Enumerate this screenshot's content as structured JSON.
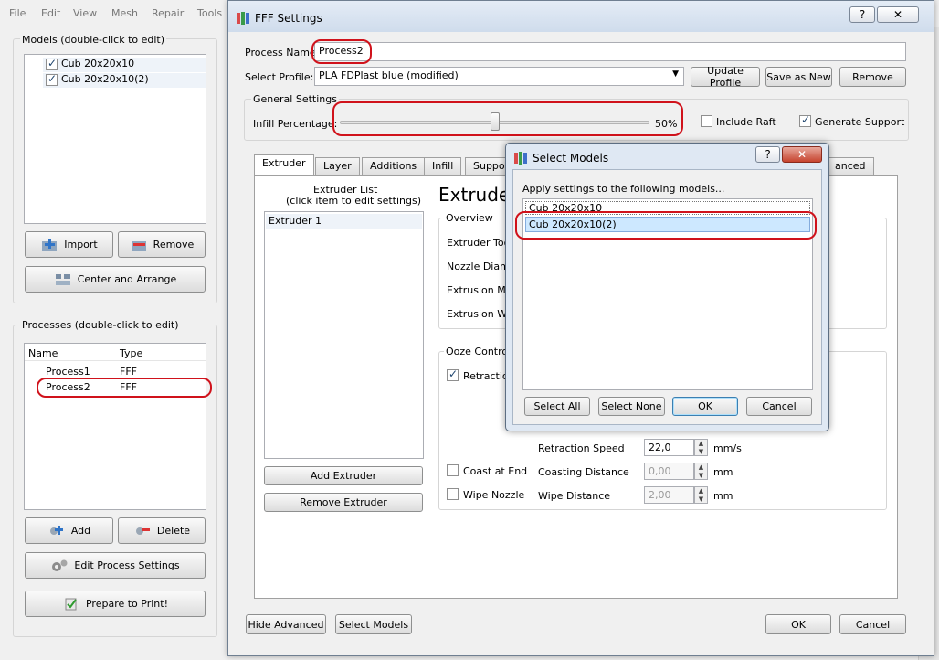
{
  "menu": {
    "items": [
      "File",
      "Edit",
      "View",
      "Mesh",
      "Repair",
      "Tools"
    ]
  },
  "models_panel": {
    "title": "Models (double-click to edit)",
    "items": [
      {
        "label": "Cub 20x20x10",
        "checked": true
      },
      {
        "label": "Cub 20x20x10(2)",
        "checked": true
      }
    ],
    "import_label": "Import",
    "remove_label": "Remove",
    "center_label": "Center and Arrange"
  },
  "processes_panel": {
    "title": "Processes (double-click to edit)",
    "col_name": "Name",
    "col_type": "Type",
    "rows": [
      {
        "name": "Process1",
        "type": "FFF"
      },
      {
        "name": "Process2",
        "type": "FFF"
      }
    ],
    "add_label": "Add",
    "delete_label": "Delete",
    "edit_label": "Edit Process Settings",
    "prepare_label": "Prepare to Print!"
  },
  "fff": {
    "title": "FFF Settings",
    "help": "?",
    "close": "✕",
    "process_name_label": "Process Name:",
    "process_name_value": "Process2",
    "profile_label": "Select Profile:",
    "profile_value": "PLA FDPlast blue (modified)",
    "update_profile": "Update Profile",
    "save_as_new": "Save as New",
    "remove": "Remove",
    "general_settings": "General Settings",
    "infill_label": "Infill Percentage:",
    "infill_value": "50%",
    "infill_fraction": 0.5,
    "include_raft": "Include Raft",
    "include_raft_checked": false,
    "generate_support": "Generate Support",
    "generate_support_checked": true,
    "tabs": [
      "Extruder",
      "Layer",
      "Additions",
      "Infill",
      "Suppor",
      "anced"
    ],
    "extruder_list_title_1": "Extruder List",
    "extruder_list_title_2": "(click item to edit settings)",
    "extruder_item": "Extruder 1",
    "add_extruder": "Add Extruder",
    "remove_extruder": "Remove Extruder",
    "extruder_heading": "Extrude",
    "overview_title": "Overview",
    "overview_rows": [
      "Extruder Tool",
      "Nozzle Diame",
      "Extrusion Mul",
      "Extrusion Wid"
    ],
    "ooze_title": "Ooze Control",
    "retraction_label": "Retraction",
    "retraction_checked": true,
    "retraction_speed_label": "Retraction Speed",
    "retraction_speed_value": "22,0",
    "retraction_speed_unit": "mm/s",
    "coast_at_end": "Coast at End",
    "coasting_distance_label": "Coasting Distance",
    "coasting_distance_value": "0,00",
    "coasting_unit": "mm",
    "wipe_nozzle": "Wipe Nozzle",
    "wipe_distance_label": "Wipe Distance",
    "wipe_distance_value": "2,00",
    "wipe_unit": "mm",
    "hide_advanced": "Hide Advanced",
    "select_models": "Select Models",
    "ok": "OK",
    "cancel": "Cancel"
  },
  "select_models_dialog": {
    "title": "Select Models",
    "help": "?",
    "close": "✕",
    "instruction": "Apply settings to the following models...",
    "items": [
      "Cub 20x20x10",
      "Cub 20x20x10(2)"
    ],
    "select_all": "Select All",
    "select_none": "Select None",
    "ok": "OK",
    "cancel": "Cancel"
  },
  "colors": {
    "highlight_red": "#d0121b",
    "selection_blue": "#cde8ff",
    "titlebar": "#dbe6f4"
  }
}
